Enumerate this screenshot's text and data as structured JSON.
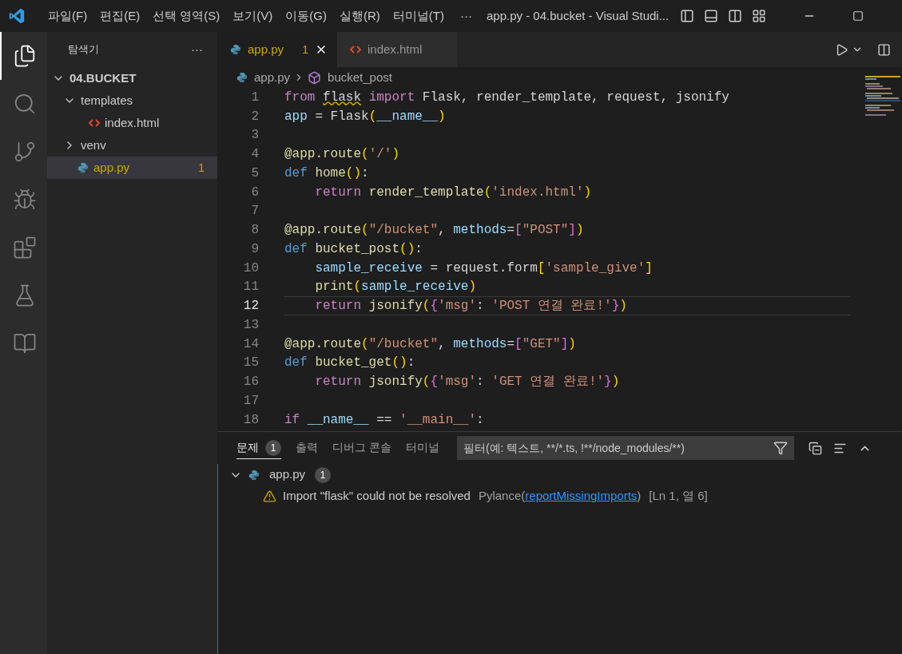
{
  "title_bar": {
    "menus": [
      "파일(F)",
      "편집(E)",
      "선택 영역(S)",
      "보기(V)",
      "이동(G)",
      "실행(R)",
      "터미널(T)"
    ],
    "more": "···",
    "title": "app.py - 04.bucket - Visual Studi..."
  },
  "activity_bar": [
    {
      "kind": "explorer",
      "selected": true
    },
    {
      "kind": "search",
      "selected": false
    },
    {
      "kind": "source-control",
      "selected": false
    },
    {
      "kind": "run-debug",
      "selected": false
    },
    {
      "kind": "extensions",
      "selected": false
    },
    {
      "kind": "testing",
      "selected": false
    },
    {
      "kind": "notebook",
      "selected": false
    }
  ],
  "sidebar": {
    "title": "탐색기",
    "more": "···",
    "tree": [
      {
        "label": "04.BUCKET",
        "kind": "root",
        "expanded": true,
        "selected": false,
        "children": [
          {
            "label": "templates",
            "kind": "folder",
            "expanded": true,
            "selected": false,
            "children": [
              {
                "label": "index.html",
                "kind": "html",
                "selected": false
              }
            ]
          },
          {
            "label": "venv",
            "kind": "folder",
            "expanded": false,
            "selected": false
          },
          {
            "label": "app.py",
            "kind": "python",
            "selected": true,
            "warning": true,
            "badge": "1"
          }
        ]
      }
    ]
  },
  "tabs": [
    {
      "label": "app.py",
      "kind": "python",
      "selected": true,
      "warning": true,
      "badge": "1"
    },
    {
      "label": "index.html",
      "kind": "html",
      "selected": false,
      "warning": false
    }
  ],
  "breadcrumb": [
    {
      "label": "app.py",
      "kind": "python"
    },
    {
      "label": "bucket_post",
      "kind": "symbol"
    }
  ],
  "code_lines": [
    {
      "number": "1",
      "current": false,
      "tokens": [
        {
          "kind": "kw",
          "text": "from "
        },
        {
          "kind": "warn",
          "text": "flask"
        },
        {
          "kind": "kw",
          "text": " import"
        },
        {
          "kind": "p",
          "text": " Flask, render_template, request, jsonify"
        }
      ]
    },
    {
      "number": "2",
      "current": false,
      "tokens": [
        {
          "kind": "var",
          "text": "app"
        },
        {
          "kind": "p",
          "text": " = Flask"
        },
        {
          "kind": "b1",
          "text": "("
        },
        {
          "kind": "var",
          "text": "__name__"
        },
        {
          "kind": "b1",
          "text": ")"
        }
      ]
    },
    {
      "number": "3",
      "current": false
    },
    {
      "number": "4",
      "current": false,
      "tokens": [
        {
          "kind": "fn",
          "text": "@app.route"
        },
        {
          "kind": "b1",
          "text": "("
        },
        {
          "kind": "str",
          "text": "'/'"
        },
        {
          "kind": "b1",
          "text": ")"
        }
      ]
    },
    {
      "number": "5",
      "current": false,
      "tokens": [
        {
          "kind": "def",
          "text": "def "
        },
        {
          "kind": "fn",
          "text": "home"
        },
        {
          "kind": "b1",
          "text": "()"
        },
        {
          "kind": "p",
          "text": ":"
        }
      ]
    },
    {
      "number": "6",
      "current": false,
      "tokens": [
        {
          "kind": "kw",
          "text": "    return "
        },
        {
          "kind": "fn",
          "text": "render_template"
        },
        {
          "kind": "b1",
          "text": "("
        },
        {
          "kind": "str",
          "text": "'index.html'"
        },
        {
          "kind": "b1",
          "text": ")"
        }
      ]
    },
    {
      "number": "7",
      "current": false
    },
    {
      "number": "8",
      "current": false,
      "tokens": [
        {
          "kind": "fn",
          "text": "@app.route"
        },
        {
          "kind": "b1",
          "text": "("
        },
        {
          "kind": "str",
          "text": "\"/bucket\""
        },
        {
          "kind": "p",
          "text": ", "
        },
        {
          "kind": "var",
          "text": "methods"
        },
        {
          "kind": "p",
          "text": "="
        },
        {
          "kind": "b2",
          "text": "["
        },
        {
          "kind": "str",
          "text": "\"POST\""
        },
        {
          "kind": "b2",
          "text": "]"
        },
        {
          "kind": "b1",
          "text": ")"
        }
      ]
    },
    {
      "number": "9",
      "current": false,
      "tokens": [
        {
          "kind": "def",
          "text": "def "
        },
        {
          "kind": "fn",
          "text": "bucket_post"
        },
        {
          "kind": "b1",
          "text": "()"
        },
        {
          "kind": "p",
          "text": ":"
        }
      ]
    },
    {
      "number": "10",
      "current": false,
      "tokens": [
        {
          "kind": "var",
          "text": "    sample_receive"
        },
        {
          "kind": "p",
          "text": " = request.form"
        },
        {
          "kind": "b1",
          "text": "["
        },
        {
          "kind": "str",
          "text": "'sample_give'"
        },
        {
          "kind": "b1",
          "text": "]"
        }
      ]
    },
    {
      "number": "11",
      "current": false,
      "tokens": [
        {
          "kind": "fn",
          "text": "    print"
        },
        {
          "kind": "b1",
          "text": "("
        },
        {
          "kind": "var",
          "text": "sample_receive"
        },
        {
          "kind": "b1",
          "text": ")"
        }
      ]
    },
    {
      "number": "12",
      "current": true,
      "tokens": [
        {
          "kind": "kw",
          "text": "    return "
        },
        {
          "kind": "fn",
          "text": "jsonify"
        },
        {
          "kind": "b1",
          "text": "("
        },
        {
          "kind": "b2",
          "text": "{"
        },
        {
          "kind": "str",
          "text": "'msg'"
        },
        {
          "kind": "p",
          "text": ": "
        },
        {
          "kind": "str",
          "text": "'POST 연결 완료!'"
        },
        {
          "kind": "b2",
          "text": "}"
        },
        {
          "kind": "b1",
          "text": ")"
        }
      ]
    },
    {
      "number": "13",
      "current": false
    },
    {
      "number": "14",
      "current": false,
      "tokens": [
        {
          "kind": "fn",
          "text": "@app.route"
        },
        {
          "kind": "b1",
          "text": "("
        },
        {
          "kind": "str",
          "text": "\"/bucket\""
        },
        {
          "kind": "p",
          "text": ", "
        },
        {
          "kind": "var",
          "text": "methods"
        },
        {
          "kind": "p",
          "text": "="
        },
        {
          "kind": "b2",
          "text": "["
        },
        {
          "kind": "str",
          "text": "\"GET\""
        },
        {
          "kind": "b2",
          "text": "]"
        },
        {
          "kind": "b1",
          "text": ")"
        }
      ]
    },
    {
      "number": "15",
      "current": false,
      "tokens": [
        {
          "kind": "def",
          "text": "def "
        },
        {
          "kind": "fn",
          "text": "bucket_get"
        },
        {
          "kind": "b1",
          "text": "()"
        },
        {
          "kind": "p",
          "text": ":"
        }
      ]
    },
    {
      "number": "16",
      "current": false,
      "tokens": [
        {
          "kind": "kw",
          "text": "    return "
        },
        {
          "kind": "fn",
          "text": "jsonify"
        },
        {
          "kind": "b1",
          "text": "("
        },
        {
          "kind": "b2",
          "text": "{"
        },
        {
          "kind": "str",
          "text": "'msg'"
        },
        {
          "kind": "p",
          "text": ": "
        },
        {
          "kind": "str",
          "text": "'GET 연결 완료!'"
        },
        {
          "kind": "b2",
          "text": "}"
        },
        {
          "kind": "b1",
          "text": ")"
        }
      ]
    },
    {
      "number": "17",
      "current": false
    },
    {
      "number": "18",
      "current": false,
      "tokens": [
        {
          "kind": "kw",
          "text": "if "
        },
        {
          "kind": "var",
          "text": "__name__"
        },
        {
          "kind": "p",
          "text": " == "
        },
        {
          "kind": "str",
          "text": "'__main__'"
        },
        {
          "kind": "p",
          "text": ":"
        }
      ]
    }
  ],
  "panel": {
    "tabs": [
      {
        "label": "문제",
        "selected": true,
        "badge": "1"
      },
      {
        "label": "출력",
        "selected": false
      },
      {
        "label": "디버그 콘솔",
        "selected": false
      },
      {
        "label": "터미널",
        "selected": false
      }
    ],
    "filter": {
      "placeholder": "필터(예: 텍스트, **/*.ts, !**/node_modules/**)"
    },
    "problems": [
      {
        "file": "app.py",
        "kind": "python",
        "expanded": true,
        "count": "1",
        "items": [
          {
            "warning": true,
            "message": "Import \"flask\" could not be resolved",
            "source_prefix": "Pylance(",
            "code": "reportMissingImports",
            "source_suffix": ")",
            "location": "[Ln 1, 열 6]"
          }
        ]
      }
    ]
  }
}
